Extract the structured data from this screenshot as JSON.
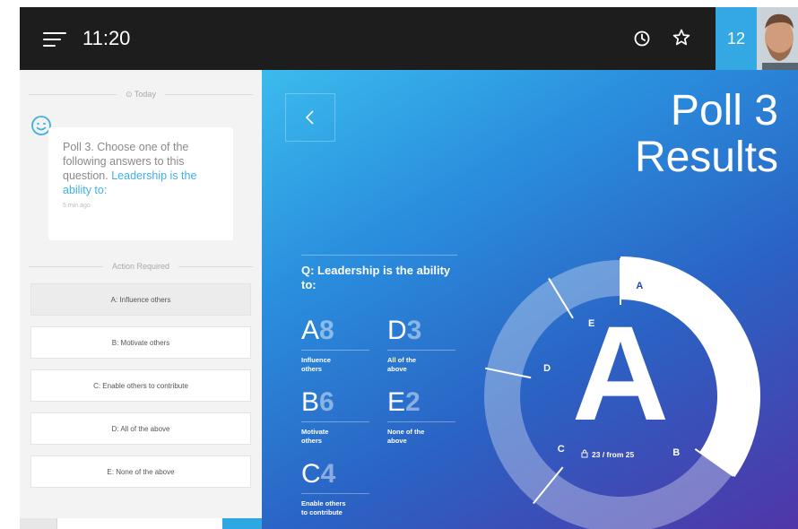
{
  "topbar": {
    "time": "11:20",
    "badge_count": "12",
    "icons": [
      "menu-icon",
      "history-icon",
      "star-icon"
    ]
  },
  "left_panel": {
    "today_label": "⊙ Today",
    "message": {
      "text_plain": "Poll 3. Choose one of the following answers to this question. ",
      "text_highlight": "Leadership is the ability to:",
      "time": "5 min ago"
    },
    "action_label": "Action Required",
    "options": [
      {
        "label": "A: Influence others",
        "selected": true
      },
      {
        "label": "B: Motivate others",
        "selected": false
      },
      {
        "label": "C: Enable others to contribute",
        "selected": false
      },
      {
        "label": "D: All of the above",
        "selected": false
      },
      {
        "label": "E: None of the above",
        "selected": false
      }
    ]
  },
  "right_panel": {
    "title_line1": "Poll 3",
    "title_line2": "Results",
    "question": "Q: Leadership is the ability to:",
    "results": [
      {
        "letter": "A",
        "count": "8",
        "label_line1": "Influence",
        "label_line2": "others"
      },
      {
        "letter": "D",
        "count": "3",
        "label_line1": "All of the",
        "label_line2": "above"
      },
      {
        "letter": "B",
        "count": "6",
        "label_line1": "Motivate",
        "label_line2": "others"
      },
      {
        "letter": "E",
        "count": "2",
        "label_line1": "None of the",
        "label_line2": "above"
      },
      {
        "letter": "C",
        "count": "4",
        "label_line1": "Enable others",
        "label_line2": "to contribute"
      }
    ],
    "winner": "A",
    "votes_text": "23 / from 25",
    "colors": {
      "accent": "#33a8e3",
      "topbar": "#1d1d1d",
      "highlight_text": "#3fb0e6"
    }
  }
}
